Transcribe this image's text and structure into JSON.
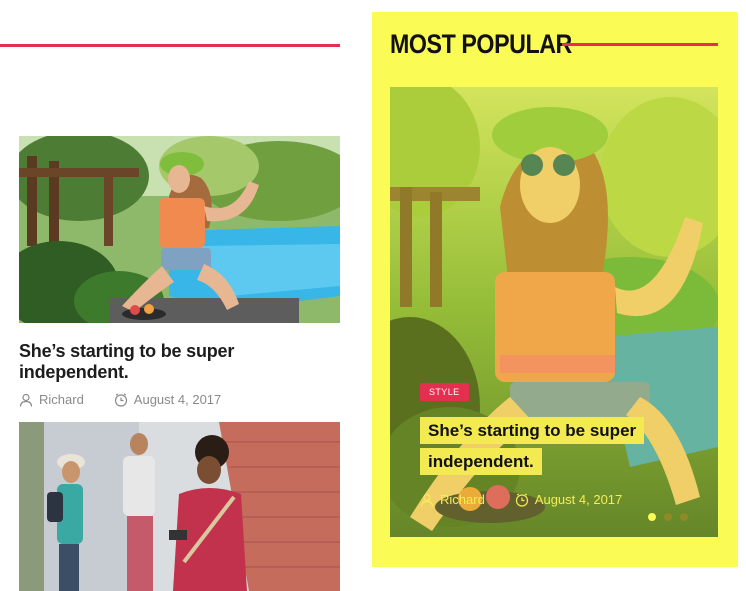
{
  "left_column": {
    "articles": [
      {
        "title": "She’s starting to be super independent.",
        "author": "Richard",
        "date": "August 4, 2017"
      },
      {
        "title": "",
        "author": "",
        "date": ""
      }
    ]
  },
  "most_popular": {
    "heading": "MOST POPULAR",
    "feature": {
      "category": "STYLE",
      "title": "She’s starting to be super independent.",
      "author": "Richard",
      "date": "August 4, 2017"
    },
    "carousel": {
      "total_slides": 3,
      "active_slide": 1
    }
  },
  "colors": {
    "accent_red": "#e4304f",
    "panel_yellow": "#fbfb55",
    "title_highlight": "#f3ea52"
  },
  "icons": [
    "user-icon",
    "clock-icon"
  ]
}
